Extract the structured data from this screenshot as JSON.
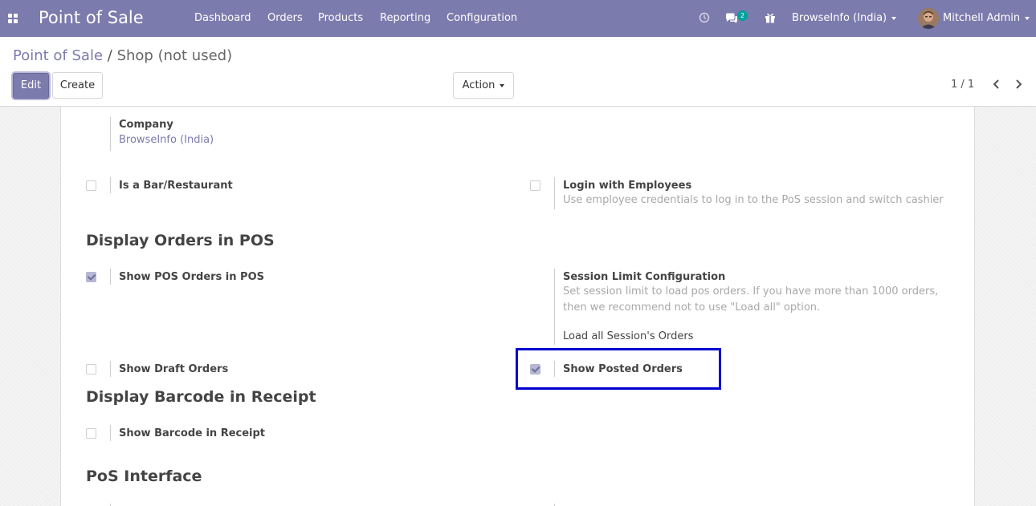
{
  "navbar": {
    "brand": "Point of Sale",
    "menu": [
      "Dashboard",
      "Orders",
      "Products",
      "Reporting",
      "Configuration"
    ],
    "messages_count": "2",
    "company": "BrowseInfo (India)",
    "user": "Mitchell Admin",
    "icons": [
      "apps-icon",
      "clock-icon",
      "chat-icon",
      "gift-icon"
    ]
  },
  "breadcrumb": {
    "parent": "Point of Sale",
    "separator": "/",
    "current": "Shop (not used)"
  },
  "buttons": {
    "edit": "Edit",
    "create": "Create",
    "action": "Action"
  },
  "pager": {
    "value": "1 / 1"
  },
  "form": {
    "company_label": "Company",
    "company_value": "BrowseInfo (India)",
    "is_bar_restaurant": {
      "label": "Is a Bar/Restaurant",
      "checked": false
    },
    "login_employees": {
      "label": "Login with Employees",
      "help": "Use employee credentials to log in to the PoS session and switch cashier",
      "checked": false
    },
    "section_display_orders": "Display Orders in POS",
    "show_pos_orders": {
      "label": "Show POS Orders in POS",
      "checked": true
    },
    "session_limit": {
      "label": "Session Limit Configuration",
      "help_line1": "Set session limit to load pos orders. If you have more than 1000 orders,",
      "help_line2": "then we recommend not to use \"Load all\" option.",
      "value": "Load all Session's Orders"
    },
    "show_draft_orders": {
      "label": "Show Draft Orders",
      "checked": false
    },
    "show_posted_orders": {
      "label": "Show Posted Orders",
      "checked": true
    },
    "section_barcode": "Display Barcode in Receipt",
    "show_barcode": {
      "label": "Show Barcode in Receipt",
      "checked": false
    },
    "section_pos_interface": "PoS Interface"
  },
  "colors": {
    "brand": "#7c7bad",
    "highlight": "#0000d0",
    "badge": "#00a09d"
  }
}
